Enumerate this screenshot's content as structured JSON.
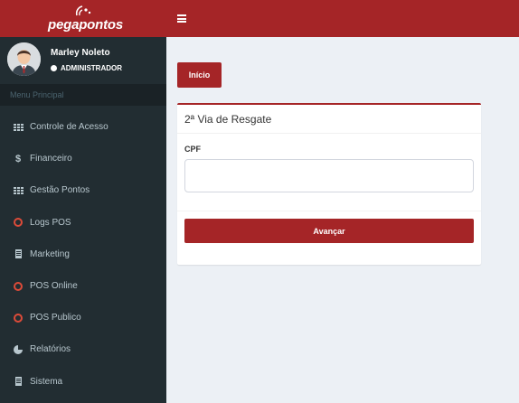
{
  "brand": {
    "logo_text": "pegapontos",
    "logo_icon": "signal-arc-icon"
  },
  "header": {
    "menu_toggle_icon": "hamburger-icon"
  },
  "user": {
    "name": "Marley Noleto",
    "role": "ADMINISTRADOR",
    "status": "online"
  },
  "sidebar": {
    "section_header": "Menu Principal",
    "items": [
      {
        "label": "Controle de Acesso",
        "icon": "grid-icon"
      },
      {
        "label": "Financeiro",
        "icon": "dollar-icon"
      },
      {
        "label": "Gestão Pontos",
        "icon": "grid-icon"
      },
      {
        "label": "Logs POS",
        "icon": "circle-icon"
      },
      {
        "label": "Marketing",
        "icon": "building-icon"
      },
      {
        "label": "POS Online",
        "icon": "circle-icon"
      },
      {
        "label": "POS Publico",
        "icon": "circle-icon"
      },
      {
        "label": "Relatórios",
        "icon": "pie-chart-icon"
      },
      {
        "label": "Sistema",
        "icon": "building-icon"
      }
    ]
  },
  "main": {
    "breadcrumb_button": "Início",
    "panel": {
      "title": "2ª Via de Resgate",
      "cpf_label": "CPF",
      "cpf_value": "",
      "submit_label": "Avançar"
    }
  },
  "colors": {
    "brand_red": "#a52527",
    "sidebar_bg": "#222d32",
    "content_bg": "#ecf0f5",
    "icon_ring": "#dd4b39"
  }
}
